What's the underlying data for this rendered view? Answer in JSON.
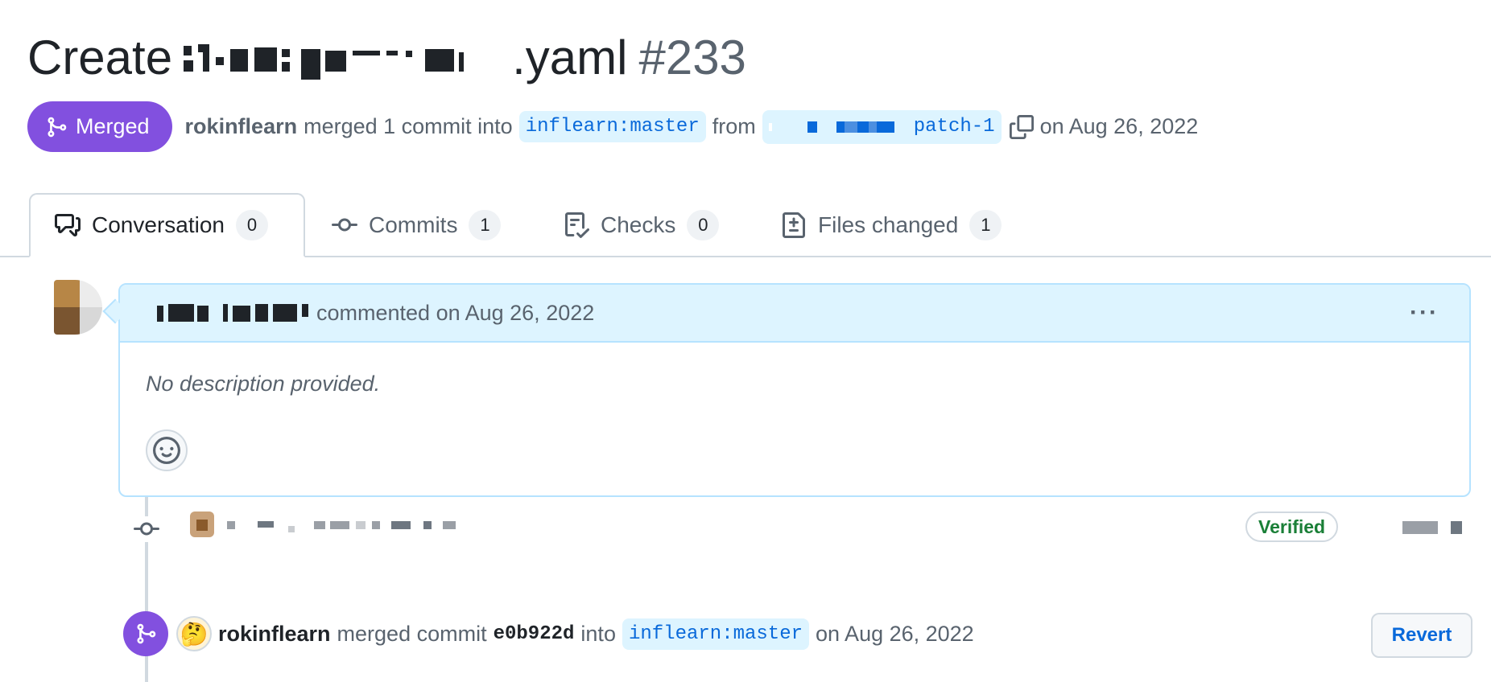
{
  "pr": {
    "title_prefix": "Create",
    "title_suffix": ".yaml",
    "number": "#233",
    "state": "Merged",
    "author": "rokinflearn",
    "action_text": "merged 1 commit into",
    "base_branch": "inflearn:master",
    "from_text": "from",
    "head_branch_suffix": "patch-1",
    "date_text": "on Aug 26, 2022"
  },
  "tabs": [
    {
      "label": "Conversation",
      "count": "0",
      "icon": "comment-discussion-icon"
    },
    {
      "label": "Commits",
      "count": "1",
      "icon": "git-commit-icon"
    },
    {
      "label": "Checks",
      "count": "0",
      "icon": "checklist-icon"
    },
    {
      "label": "Files changed",
      "count": "1",
      "icon": "file-diff-icon"
    }
  ],
  "comment": {
    "header_text": "commented on Aug 26, 2022",
    "menu": "···",
    "body": "No description provided."
  },
  "commit": {
    "badge": "Verified"
  },
  "merge_event": {
    "avatar_emoji": "🤔",
    "author": "rokinflearn",
    "text1": "merged commit",
    "sha": "e0b922d",
    "text2": "into",
    "branch": "inflearn:master",
    "date": "on Aug 26, 2022",
    "revert_label": "Revert"
  },
  "colors": {
    "merged_purple": "#8250df",
    "link_blue": "#0969da",
    "branch_bg": "#ddf4ff",
    "verified_green": "#1a7f37"
  }
}
